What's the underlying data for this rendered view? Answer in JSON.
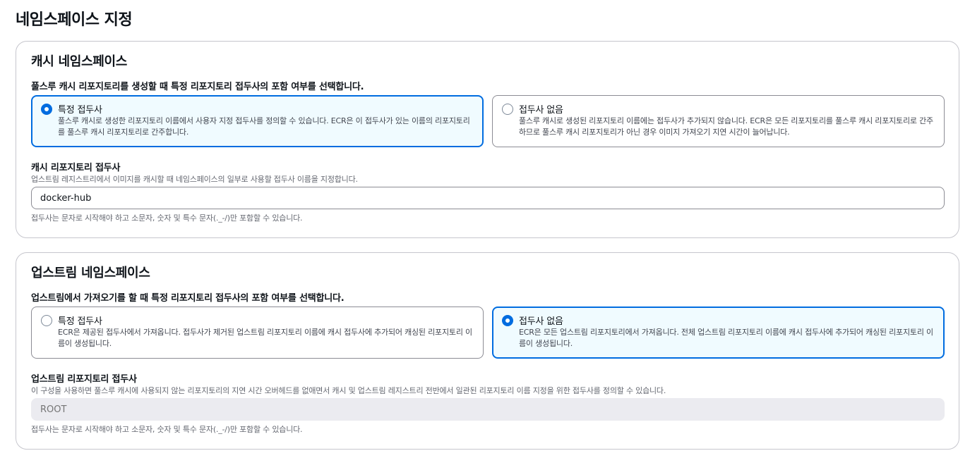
{
  "page": {
    "title": "네임스페이스 지정"
  },
  "cache_namespace": {
    "title": "캐시 네임스페이스",
    "tile_label": "풀스루 캐시 리포지토리를 생성할 때 특정 리포지토리 접두사의 포함 여부를 선택합니다.",
    "options": [
      {
        "title": "특정 접두사",
        "description": "풀스루 캐시로 생성한 리포지토리 이름에서 사용자 지정 접두사를 정의할 수 있습니다. ECR은 이 접두사가 있는 이름의 리포지토리를 풀스루 캐시 리포지토리로 간주합니다.",
        "selected": true
      },
      {
        "title": "접두사 없음",
        "description": "풀스루 캐시로 생성된 리포지토리 이름에는 접두사가 추가되지 않습니다. ECR은 모든 리포지토리를 풀스루 캐시 리포지토리로 간주하므로 풀스루 캐시 리포지토리가 아닌 경우 이미지 가져오기 지연 시간이 늘어납니다.",
        "selected": false
      }
    ],
    "field": {
      "label": "캐시 리포지토리 접두사",
      "description": "업스트림 레지스트리에서 이미지를 캐시할 때 네임스페이스의 일부로 사용할 접두사 이름을 지정합니다.",
      "value": "docker-hub",
      "constraint": "접두사는 문자로 시작해야 하고 소문자, 숫자 및 특수 문자(._-/)만 포함할 수 있습니다."
    }
  },
  "upstream_namespace": {
    "title": "업스트림 네임스페이스",
    "tile_label": "업스트림에서 가져오기를 할 때 특정 리포지토리 접두사의 포함 여부를 선택합니다.",
    "options": [
      {
        "title": "특정 접두사",
        "description": "ECR은 제공된 접두사에서 가져옵니다. 접두사가 제거된 업스트림 리포지토리 이름에 캐시 접두사에 추가되어 캐싱된 리포지토리 이름이 생성됩니다.",
        "selected": false
      },
      {
        "title": "접두사 없음",
        "description": "ECR은 모든 업스트림 리포지토리에서 가져옵니다. 전체 업스트림 리포지토리 이름에 캐시 접두사에 추가되어 캐싱된 리포지토리 이름이 생성됩니다.",
        "selected": true
      }
    ],
    "field": {
      "label": "업스트림 리포지토리 접두사",
      "description": "이 구성을 사용하면 풀스루 캐시에 사용되지 않는 리포지토리의 지연 시간 오버헤드를 없애면서 캐시 및 업스트림 레지스트리 전반에서 일관된 리포지토리 이름 지정을 위한 접두사를 정의할 수 있습니다.",
      "placeholder": "ROOT",
      "disabled": true,
      "constraint": "접두사는 문자로 시작해야 하고 소문자, 숫자 및 특수 문자(._-/)만 포함할 수 있습니다."
    }
  },
  "colors": {
    "accent": "#006ce0",
    "selected_background": "#f0fbff",
    "border": "#8c8c94",
    "container_border": "#c6c6cd",
    "disabled_input": "#ebebf0"
  }
}
